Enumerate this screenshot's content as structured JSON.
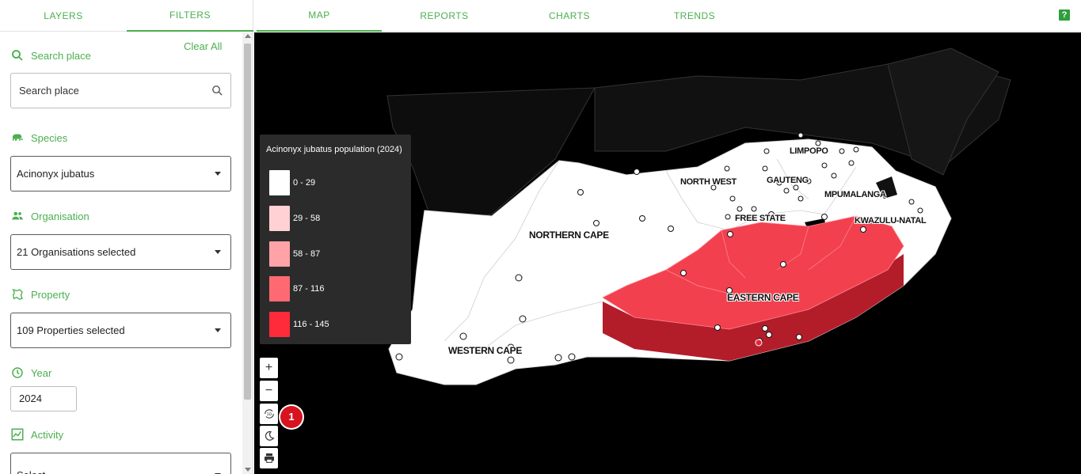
{
  "left_tabs": {
    "layers": "LAYERS",
    "filters": "FILTERS"
  },
  "filters": {
    "clear_all": "Clear All",
    "search_place": {
      "label": "Search place",
      "placeholder": "Search place"
    },
    "species": {
      "label": "Species",
      "value": "Acinonyx jubatus"
    },
    "organisation": {
      "label": "Organisation",
      "value": "21 Organisations selected"
    },
    "property": {
      "label": "Property",
      "value": "109 Properties selected"
    },
    "year": {
      "label": "Year",
      "value": "2024"
    },
    "activity": {
      "label": "Activity",
      "value": "Select"
    }
  },
  "nav": {
    "map": "MAP",
    "reports": "REPORTS",
    "charts": "CHARTS",
    "trends": "TRENDS",
    "help": "?"
  },
  "legend": {
    "title": "Acinonyx jubatus population (2024)",
    "items": [
      {
        "label": "0 - 29",
        "color": "#ffffff"
      },
      {
        "label": "29 - 58",
        "color": "#ffd1d4"
      },
      {
        "label": "58 - 87",
        "color": "#ffa3a8"
      },
      {
        "label": "87 - 116",
        "color": "#ff6a72"
      },
      {
        "label": "116 - 145",
        "color": "#ff2a3a"
      }
    ]
  },
  "map": {
    "labels": {
      "limpopo": "LIMPOPO",
      "north_west": "NORTH WEST",
      "gauteng": "GAUTENG",
      "mpumalanga": "MPUMALANGA",
      "free_state": "FREE STATE",
      "kwazulu_natal": "KWAZULU-NATAL",
      "northern_cape": "NORTHERN CAPE",
      "eastern_cape": "EASTERN CAPE",
      "western_cape": "WESTERN CAPE"
    },
    "controls": {
      "zoom_in": "+",
      "zoom_out": "−",
      "three_d": "3D"
    },
    "badge_count": "1"
  },
  "colors": {
    "accent": "#4caf50",
    "badge": "#d6131f",
    "map_background": "#000000"
  }
}
